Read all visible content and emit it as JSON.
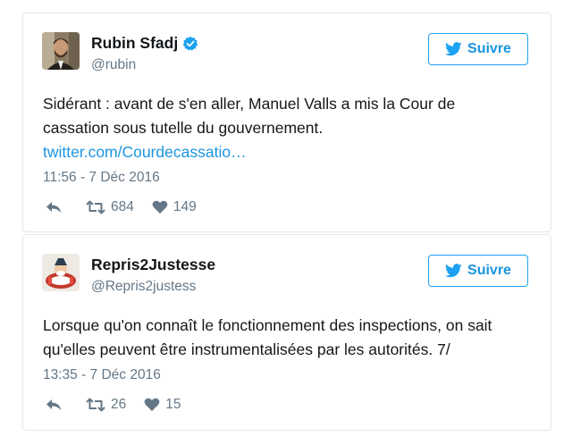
{
  "tweets": [
    {
      "display_name": "Rubin Sfadj",
      "verified": true,
      "handle": "@rubin",
      "follow_label": "Suivre",
      "text_lines": [
        "Sidérant : avant de s'en aller, Manuel Valls a mis la Cour de",
        "cassation sous tutelle du gouvernement."
      ],
      "link": "twitter.com/Courdecassatio…",
      "timestamp": "11:56 - 7 Déc 2016",
      "retweets": "684",
      "likes": "149"
    },
    {
      "display_name": "Repris2Justesse",
      "verified": false,
      "handle": "@Repris2justess",
      "follow_label": "Suivre",
      "text_lines": [
        "Lorsque qu'on connaît le fonctionnement des inspections, on sait",
        "qu'elles peuvent être instrumentalisées par les autorités. 7/"
      ],
      "timestamp": "13:35 - 7 Déc 2016",
      "retweets": "26",
      "likes": "15"
    }
  ],
  "colors": {
    "accent": "#1da1f2",
    "link": "#1b95e0",
    "muted": "#657786",
    "border": "#e1e8ed"
  },
  "icons": [
    "twitter-bird-icon",
    "verified-badge-icon",
    "reply-icon",
    "retweet-icon",
    "heart-icon"
  ]
}
